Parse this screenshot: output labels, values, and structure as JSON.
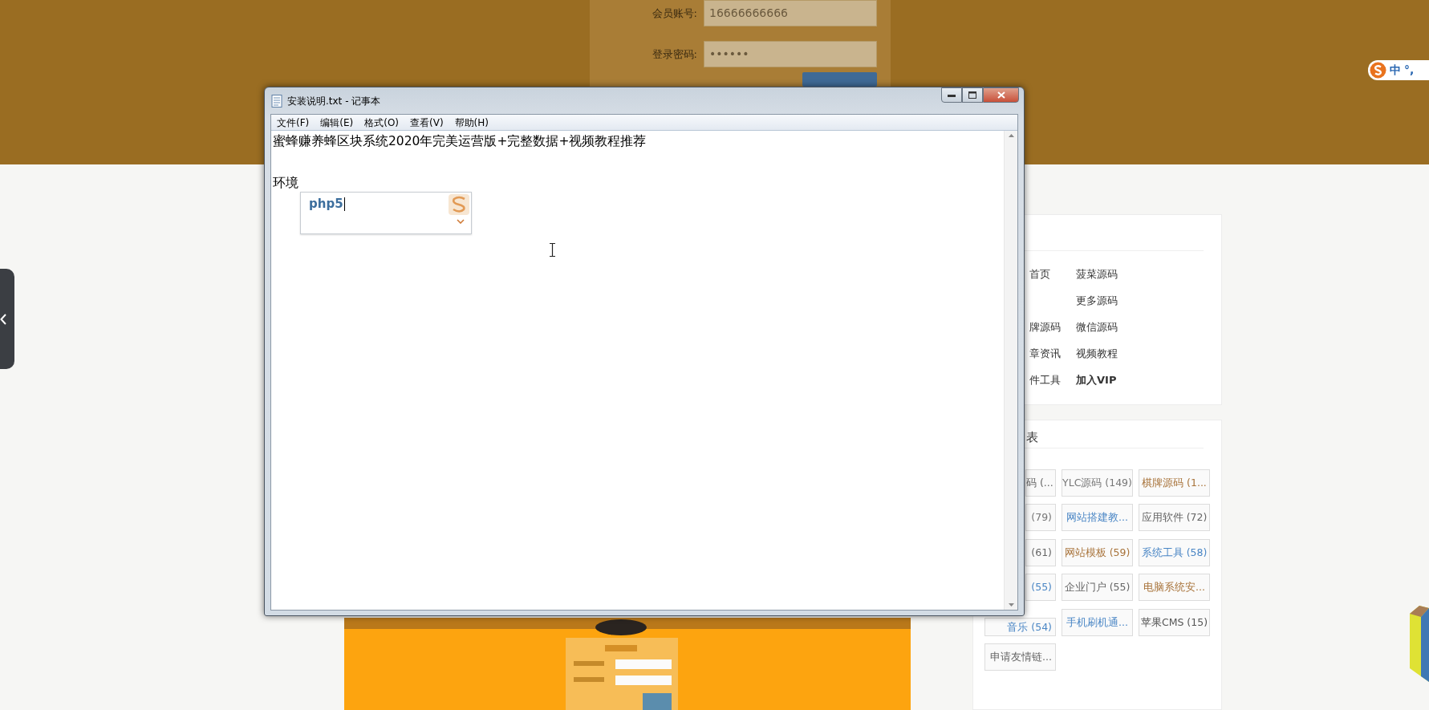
{
  "login_form": {
    "fields": [
      {
        "label": "会员账号:",
        "value": "16666666666"
      },
      {
        "label": "登录密码:",
        "value": "••••••"
      }
    ]
  },
  "ime_toolbar": {
    "mode": "中",
    "punctuation": "°,"
  },
  "notepad": {
    "title": "安装说明.txt - 记事本",
    "menu": [
      "文件(F)",
      "编辑(E)",
      "格式(O)",
      "查看(V)",
      "帮助(H)"
    ],
    "lines": [
      "蜜蜂赚养蜂区块系统2020年完美运营版+完整数据+视频教程推荐",
      "环境"
    ],
    "ime_candidate": {
      "text": "php5"
    }
  },
  "nav_card": {
    "rows": [
      {
        "left": {
          "text": "首页",
          "bold": false
        },
        "right": {
          "text": "菠菜源码",
          "bold": false
        }
      },
      {
        "right": {
          "text": "更多源码",
          "bold": false
        }
      },
      {
        "left": {
          "text": "牌源码",
          "bold": false
        },
        "right": {
          "text": "微信源码",
          "bold": false
        }
      },
      {
        "left": {
          "text": "章资讯",
          "bold": false
        },
        "right": {
          "text": "视频教程",
          "bold": false
        }
      },
      {
        "left": {
          "text": "件工具",
          "bold": false
        },
        "right": {
          "text": "加入VIP",
          "bold": true
        }
      }
    ]
  },
  "tag_card": {
    "title": "表",
    "tags": [
      {
        "text": "码 (...",
        "color": "#666666"
      },
      {
        "text": "YLC源码 (149)",
        "color": "#777777"
      },
      {
        "text": "棋牌源码 (1...",
        "color": "#a8733a"
      },
      {
        "text": "(79)",
        "color": "#777777"
      },
      {
        "text": "网站搭建教...",
        "color": "#4a86c5"
      },
      {
        "text": "应用软件 (72)",
        "color": "#666666"
      },
      {
        "text": "(61)",
        "color": "#666666"
      },
      {
        "text": "网站模板 (59)",
        "color": "#a8733a"
      },
      {
        "text": "系统工具 (58)",
        "color": "#4a86c5"
      },
      {
        "text": "(55)",
        "color": "#4a86c5"
      },
      {
        "text": "企业门户 (55)",
        "color": "#666666"
      },
      {
        "text": "电脑系统安...",
        "color": "#a8733a"
      },
      {
        "text": "音乐 (54)",
        "color": "#4a86c5"
      },
      {
        "text": "手机刷机通...",
        "color": "#4a86c5"
      },
      {
        "text": "苹果CMS (15)",
        "color": "#555555"
      },
      {
        "text": "申请友情链...",
        "color": "#666666"
      }
    ]
  }
}
